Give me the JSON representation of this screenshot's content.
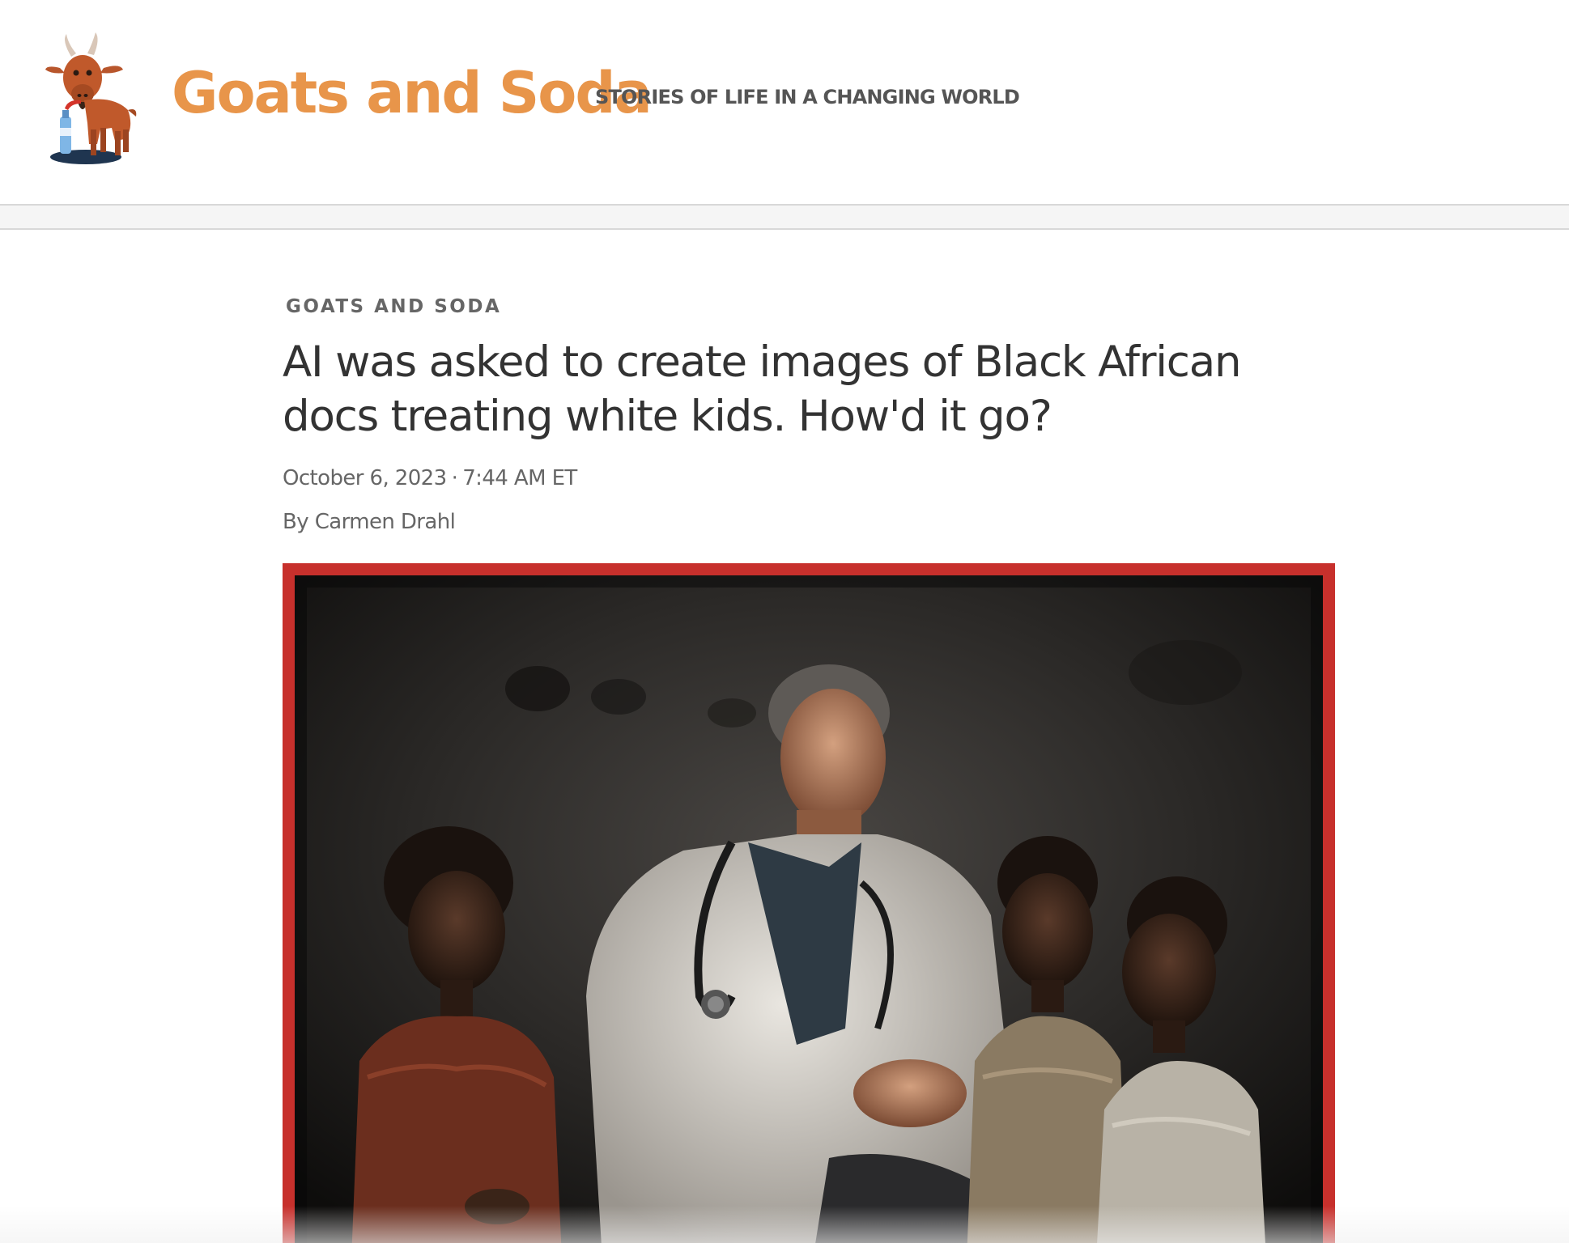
{
  "site": {
    "brand_name": "Goats and Soda",
    "tagline": "STORIES OF LIFE IN A CHANGING WORLD",
    "logo_icon": "goat-with-soda-bottle-icon",
    "brand_color": "#e8954a"
  },
  "article": {
    "section": "GOATS AND SODA",
    "headline": "AI was asked to create images of Black African docs treating white kids. How'd it go?",
    "date": "October 6, 2023",
    "separator": "·",
    "time": "7:44 AM ET",
    "byline_prefix": "By",
    "author": "Carmen Drahl",
    "lead_image": {
      "frame_color": "#c7302c"
    }
  }
}
